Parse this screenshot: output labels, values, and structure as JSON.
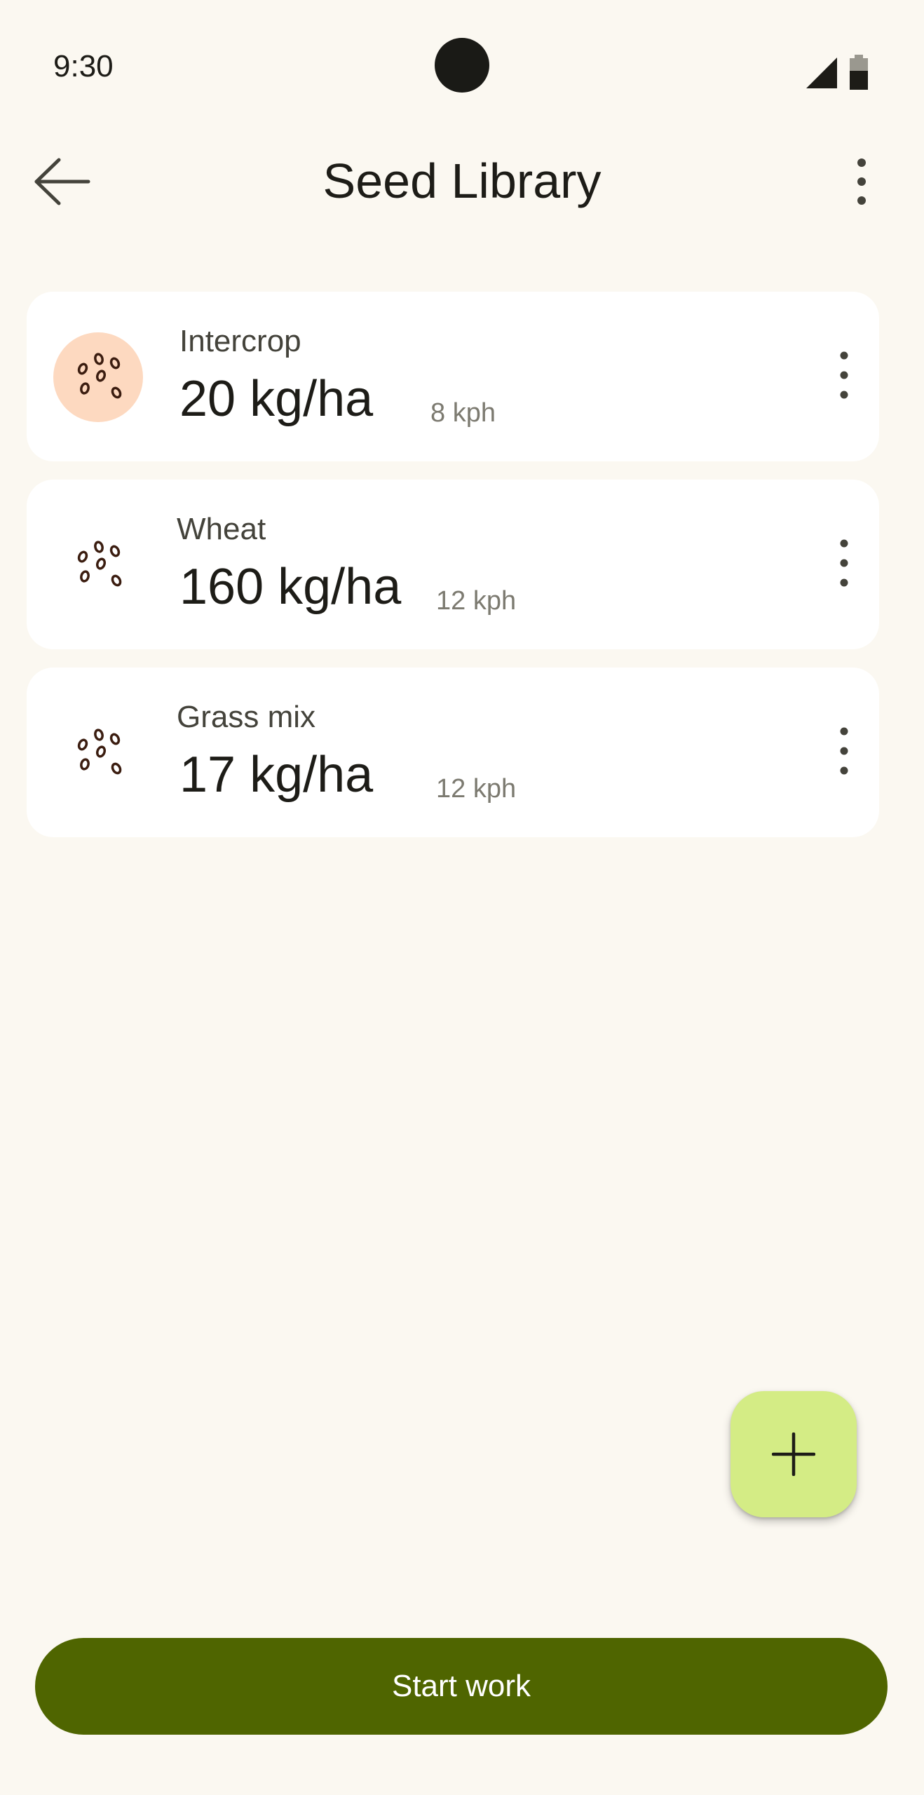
{
  "status_bar": {
    "time": "9:30",
    "icons": [
      "signal-icon",
      "battery-icon"
    ]
  },
  "top_bar": {
    "title": "Seed Library",
    "back_icon": "arrow-back-icon",
    "menu_icon": "more-vert-icon"
  },
  "seeds": [
    {
      "name": "Intercrop",
      "rate": "20 kg/ha",
      "speed": "8 kph",
      "icon": "seeds-icon",
      "selected": true
    },
    {
      "name": "Wheat",
      "rate": "160 kg/ha",
      "speed": "12 kph",
      "icon": "seeds-icon",
      "selected": false
    },
    {
      "name": "Grass mix",
      "rate": "17 kg/ha",
      "speed": "12 kph",
      "icon": "seeds-icon",
      "selected": false
    }
  ],
  "fab": {
    "icon": "add-icon"
  },
  "start_button": {
    "label": "Start work"
  },
  "colors": {
    "background": "#fbf8f1",
    "card": "#ffffff",
    "selected_avatar": "#fdd9c0",
    "fab": "#d4ec85",
    "primary": "#4f6500",
    "text": "#1d1c17"
  }
}
